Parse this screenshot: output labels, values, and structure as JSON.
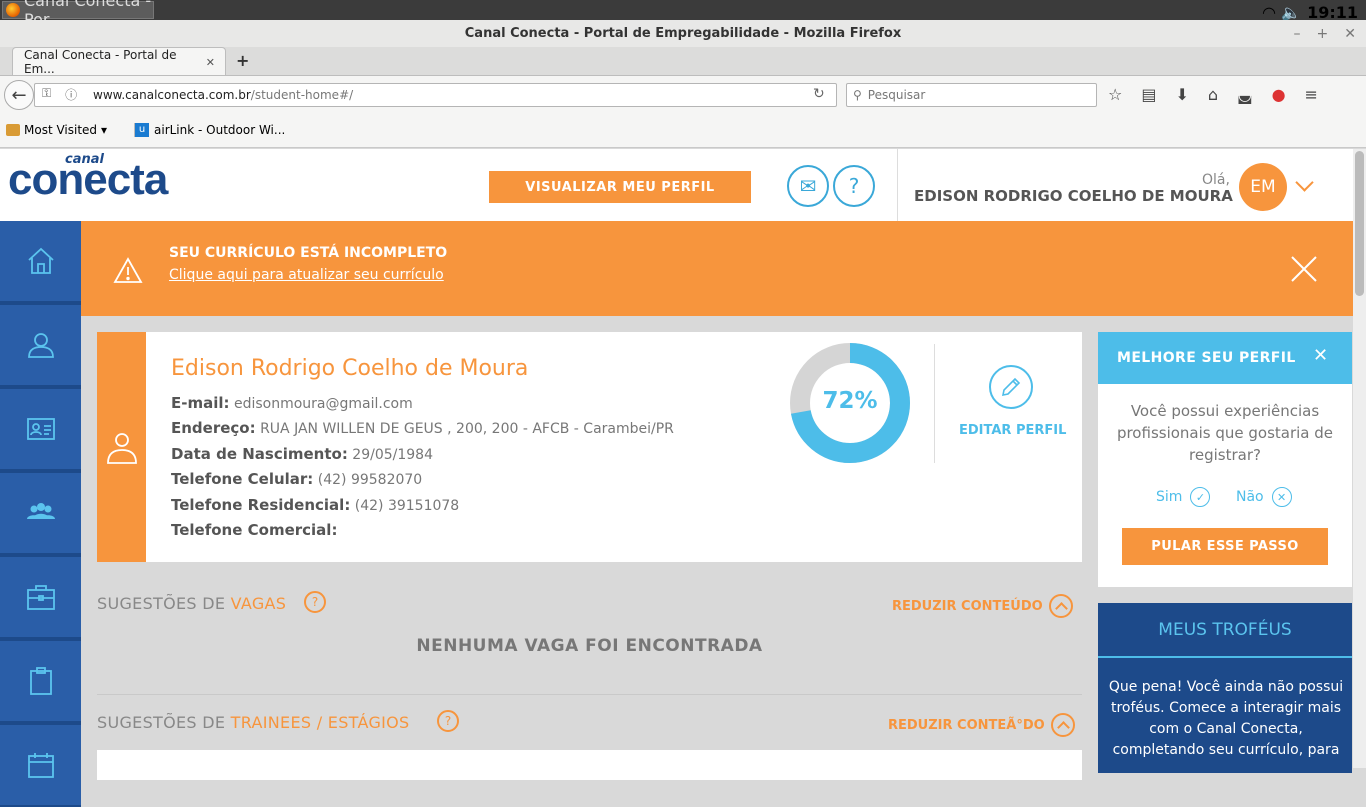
{
  "system": {
    "task_title": "Canal Conecta - Por...",
    "time": "19:11"
  },
  "window": {
    "title": "Canal Conecta - Portal de Empregabilidade - Mozilla Firefox"
  },
  "tab": {
    "title": "Canal Conecta - Portal de Em...",
    "close": "✕",
    "new": "+"
  },
  "nav": {
    "url_host": "www.canalconecta.com.br",
    "url_path": "/student-home#/",
    "search_placeholder": "Pesquisar"
  },
  "bookmarks": [
    {
      "label": "Most Visited"
    },
    {
      "label": "airLink - Outdoor Wi..."
    }
  ],
  "header": {
    "logo_small": "canal",
    "logo_main": "conecta",
    "view_profile_button": "VISUALIZAR MEU PERFIL",
    "help": "?",
    "greeting": "Olá,",
    "user_name": "EDISON RODRIGO COELHO DE MOURA",
    "avatar_initials": "EM"
  },
  "sidebar": {
    "items": [
      {
        "icon": "home-icon"
      },
      {
        "icon": "user-icon"
      },
      {
        "icon": "id-card-icon"
      },
      {
        "icon": "group-icon"
      },
      {
        "icon": "briefcase-icon"
      },
      {
        "icon": "clipboard-icon"
      },
      {
        "icon": "calendar-icon"
      }
    ]
  },
  "alert": {
    "title": "SEU CURRÍCULO ESTÁ INCOMPLETO",
    "link": "Clique aqui para atualizar seu currículo"
  },
  "profile": {
    "name": "Edison Rodrigo Coelho de Moura",
    "fields": [
      {
        "label": "E-mail:",
        "value": "edisonmoura@gmail.com"
      },
      {
        "label": "Endereço:",
        "value": "RUA JAN WILLEN DE GEUS , 200, 200 - AFCB - Carambei/PR"
      },
      {
        "label": "Data de Nascimento:",
        "value": "29/05/1984"
      },
      {
        "label": "Telefone Celular:",
        "value": "(42) 99582070"
      },
      {
        "label": "Telefone Residencial:",
        "value": "(42) 39151078"
      },
      {
        "label": "Telefone Comercial:",
        "value": ""
      }
    ],
    "completion_percent": 72,
    "completion_label": "72%",
    "edit_label": "EDITAR PERFIL"
  },
  "suggestions": {
    "vagas": {
      "prefix": "SUGESTÕES DE ",
      "highlight": "VAGAS",
      "reduce": "REDUZIR CONTEÚDO",
      "empty": "NENHUMA VAGA FOI ENCONTRADA"
    },
    "trainees": {
      "prefix": "SUGESTÕES DE ",
      "highlight": "TRAINEES / ESTÁGIOS",
      "reduce": "REDUZIR CONTEÃ°DO"
    }
  },
  "improve_panel": {
    "title": "MELHORE SEU PERFIL",
    "question": "Você possui experiências profissionais que gostaria de registrar?",
    "yes": "Sim",
    "no": "Não",
    "skip_button": "PULAR ESSE PASSO"
  },
  "trophies": {
    "title": "MEUS TROFÉUS",
    "text": "Que pena! Você ainda não possui troféus. Comece a interagir mais com o Canal Conecta, completando seu currículo, para"
  },
  "colors": {
    "accent": "#f7953d",
    "brand": "#1d4a8a",
    "info": "#4dbde9"
  }
}
